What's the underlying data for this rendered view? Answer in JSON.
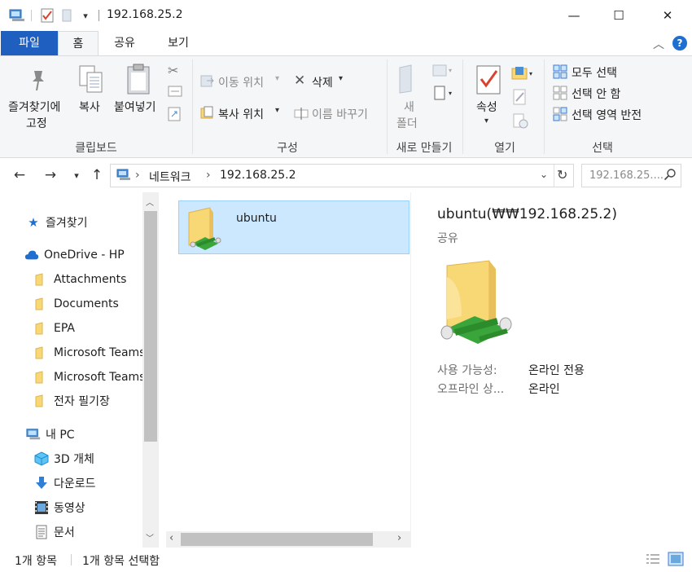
{
  "titlebar": {
    "path": "192.168.25.2",
    "quick_access_dropdown": "▾",
    "minimize": "—",
    "maximize": "☐",
    "close": "✕"
  },
  "ribbon_tabs": {
    "file": "파일",
    "home": "홈",
    "share": "공유",
    "view": "보기"
  },
  "ribbon": {
    "clipboard": {
      "label": "클립보드",
      "pin_line1": "즐겨찾기에",
      "pin_line2": "고정",
      "copy": "복사",
      "paste": "붙여넣기"
    },
    "organize": {
      "label": "구성",
      "move_to": "이동 위치",
      "copy_to": "복사 위치",
      "delete": "삭제",
      "rename": "이름 바꾸기"
    },
    "new": {
      "label": "새로 만들기",
      "new_folder_line1": "새",
      "new_folder_line2": "폴더"
    },
    "open": {
      "label": "열기",
      "properties": "속성"
    },
    "select": {
      "label": "선택",
      "select_all": "모두 선택",
      "select_none": "선택 안 함",
      "invert": "선택 영역 반전"
    }
  },
  "address": {
    "crumb_network": "네트워크",
    "crumb_host": "192.168.25.2",
    "search_placeholder": "192.168.25...."
  },
  "nav_pane": {
    "quick_access": "즐겨찾기",
    "onedrive": "OneDrive - HP",
    "folders": [
      "Attachments",
      "Documents",
      "EPA",
      "Microsoft Teams",
      "Microsoft Teams",
      "전자 필기장"
    ],
    "this_pc": "내 PC",
    "pc_items": [
      "3D 개체",
      "다운로드",
      "동영상",
      "문서"
    ]
  },
  "files": [
    {
      "name": "ubuntu"
    }
  ],
  "details": {
    "title": "ubuntu(₩₩192.168.25.2)",
    "type": "공유",
    "availability_key": "사용 가능성:",
    "availability_val": "온라인 전용",
    "offline_key": "오프라인 상...",
    "offline_val": "온라인"
  },
  "status": {
    "count": "1개 항목",
    "selected": "1개 항목 선택함"
  },
  "colors": {
    "file_tab": "#1f5fbf",
    "selection": "#cce8ff",
    "folder": "#f8d775",
    "share_green": "#3aa53a"
  }
}
